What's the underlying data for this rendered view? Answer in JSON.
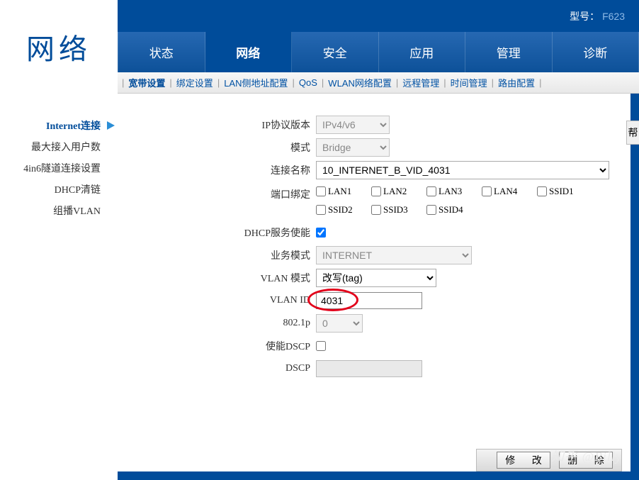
{
  "brand": "网络",
  "topbar": {
    "model_label": "型号：",
    "model_value": "F623"
  },
  "tabs": [
    "状态",
    "网络",
    "安全",
    "应用",
    "管理",
    "诊断"
  ],
  "tabs_active_index": 1,
  "subtabs": [
    "宽带设置",
    "绑定设置",
    "LAN侧地址配置",
    "QoS",
    "WLAN网络配置",
    "远程管理",
    "时间管理",
    "路由配置"
  ],
  "subtabs_active_index": 0,
  "sidebar": {
    "items": [
      "Internet连接",
      "最大接入用户数",
      "4in6隧道连接设置",
      "DHCP清链",
      "组播VLAN"
    ],
    "active_index": 0
  },
  "form": {
    "ip_version": {
      "label": "IP协议版本",
      "value": "IPv4/v6"
    },
    "mode": {
      "label": "模式",
      "value": "Bridge"
    },
    "conn_name": {
      "label": "连接名称",
      "value": "10_INTERNET_B_VID_4031"
    },
    "port_bind": {
      "label": "端口绑定",
      "items": [
        "LAN1",
        "LAN2",
        "LAN3",
        "LAN4",
        "SSID1",
        "SSID2",
        "SSID3",
        "SSID4"
      ]
    },
    "dhcp_enable": {
      "label": "DHCP服务使能",
      "checked": true
    },
    "biz_mode": {
      "label": "业务模式",
      "value": "INTERNET"
    },
    "vlan_mode": {
      "label": "VLAN 模式",
      "value": "改写(tag)"
    },
    "vlan_id": {
      "label": "VLAN ID",
      "value": "4031"
    },
    "dot1p": {
      "label": "802.1p",
      "value": "0"
    },
    "enable_dscp": {
      "label": "使能DSCP"
    },
    "dscp": {
      "label": "DSCP",
      "value": ""
    }
  },
  "actions": {
    "modify": "修 改",
    "delete": "删 除"
  },
  "help_label": "帮",
  "watermark": "知乎 @Billy"
}
